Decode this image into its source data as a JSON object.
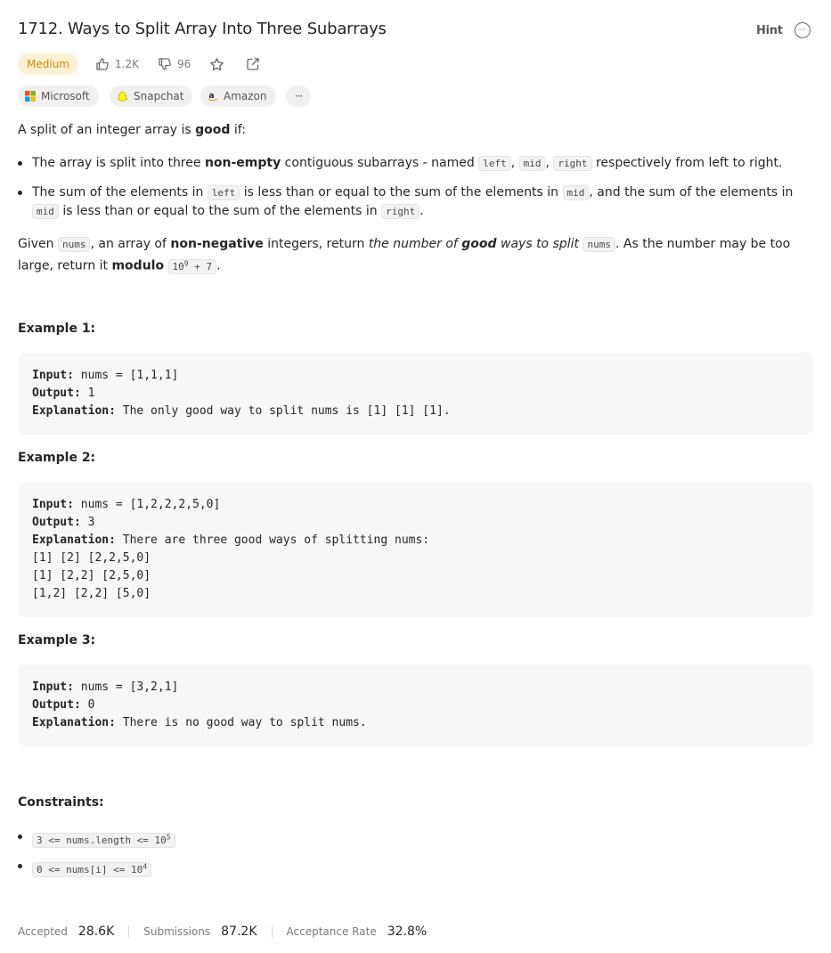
{
  "header": {
    "title": "1712. Ways to Split Array Into Three Subarrays",
    "hint_label": "Hint",
    "more_label": "···"
  },
  "meta": {
    "difficulty": "Medium",
    "likes": "1.2K",
    "dislikes": "96"
  },
  "tags": [
    {
      "label": "Microsoft",
      "icon": "microsoft-logo-icon"
    },
    {
      "label": "Snapchat",
      "icon": "snapchat-logo-icon"
    },
    {
      "label": "Amazon",
      "icon": "amazon-logo-icon"
    }
  ],
  "tags_more": "···",
  "description": {
    "intro_a": "A split of an integer array is ",
    "intro_b": "good",
    "intro_c": " if:",
    "bullet1_a": "The array is split into three ",
    "bullet1_b": "non-empty",
    "bullet1_c": " contiguous subarrays - named ",
    "bullet1_left": "left",
    "bullet1_comma1": ", ",
    "bullet1_mid": "mid",
    "bullet1_comma2": ", ",
    "bullet1_right": "right",
    "bullet1_d": " respectively from left to right.",
    "bullet2_a": "The sum of the elements in ",
    "bullet2_left": "left",
    "bullet2_b": " is less than or equal to the sum of the elements in ",
    "bullet2_mid": "mid",
    "bullet2_c": ", and the sum of the elements in ",
    "bullet2_mid2": "mid",
    "bullet2_d": " is less than or equal to the sum of the elements in ",
    "bullet2_right": "right",
    "bullet2_e": ".",
    "given_a": "Given ",
    "given_nums": "nums",
    "given_b": ", an array of ",
    "given_c": "non-negative",
    "given_d": " integers, return ",
    "given_e": "the number of ",
    "given_f": "good",
    "given_g": " ways to split",
    "given_nums2": "nums",
    "given_h": ". As the number may be too large, return it ",
    "given_i": "modulo",
    "mod_base": "10",
    "mod_exp": "9",
    "mod_tail": " + 7",
    "given_j": "."
  },
  "examples": [
    {
      "title": "Example 1:",
      "input_label": "Input:",
      "input": " nums = [1,1,1]",
      "output_label": "Output:",
      "output": " 1",
      "explanation_label": "Explanation:",
      "explanation": " The only good way to split nums is [1] [1] [1]."
    },
    {
      "title": "Example 2:",
      "input_label": "Input:",
      "input": " nums = [1,2,2,2,5,0]",
      "output_label": "Output:",
      "output": " 3",
      "explanation_label": "Explanation:",
      "explanation": " There are three good ways of splitting nums:\n[1] [2] [2,2,5,0]\n[1] [2,2] [2,5,0]\n[1,2] [2,2] [5,0]"
    },
    {
      "title": "Example 3:",
      "input_label": "Input:",
      "input": " nums = [3,2,1]",
      "output_label": "Output:",
      "output": " 0",
      "explanation_label": "Explanation:",
      "explanation": " There is no good way to split nums."
    }
  ],
  "constraints": {
    "title": "Constraints:",
    "c1_base": "3 <= nums.length <= 10",
    "c1_exp": "5",
    "c2_base": "0 <= nums[i] <= 10",
    "c2_exp": "4"
  },
  "stats": {
    "accepted_label": "Accepted",
    "accepted_value": "28.6K",
    "submissions_label": "Submissions",
    "submissions_value": "87.2K",
    "rate_label": "Acceptance Rate",
    "rate_value": "32.8%"
  },
  "colors": {
    "medium_badge_bg": "#fdf1d3",
    "medium_badge_text": "#d48806",
    "code_bg": "#f7f7f8"
  }
}
